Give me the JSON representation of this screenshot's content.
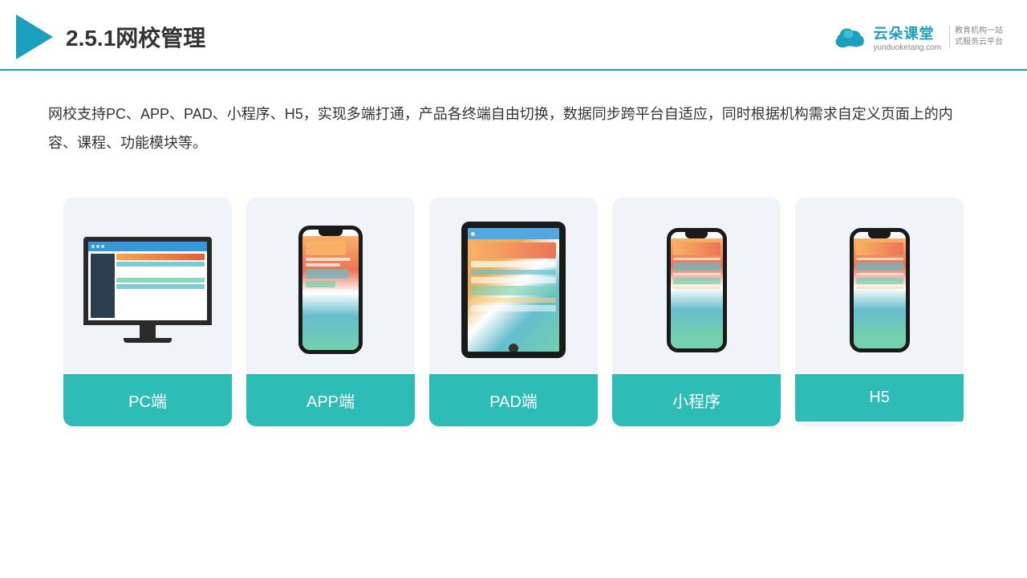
{
  "header": {
    "title": "2.5.1网校管理",
    "brand": {
      "name": "云朵课堂",
      "url": "yunduoketang.com",
      "slogan": "教育机构一站\n式服务云平台"
    }
  },
  "description": {
    "text": "网校支持PC、APP、PAD、小程序、H5，实现多端打通，产品各终端自由切换，数据同步跨平台自适应，同时根据机构需求自定义页面上的内容、课程、功能模块等。"
  },
  "cards": [
    {
      "id": "pc",
      "label": "PC端"
    },
    {
      "id": "app",
      "label": "APP端"
    },
    {
      "id": "pad",
      "label": "PAD端"
    },
    {
      "id": "miniprogram",
      "label": "小程序"
    },
    {
      "id": "h5",
      "label": "H5"
    }
  ],
  "colors": {
    "accent": "#1a9fbe",
    "teal": "#2dbcb6",
    "bg_card": "#f0f4f8"
  }
}
